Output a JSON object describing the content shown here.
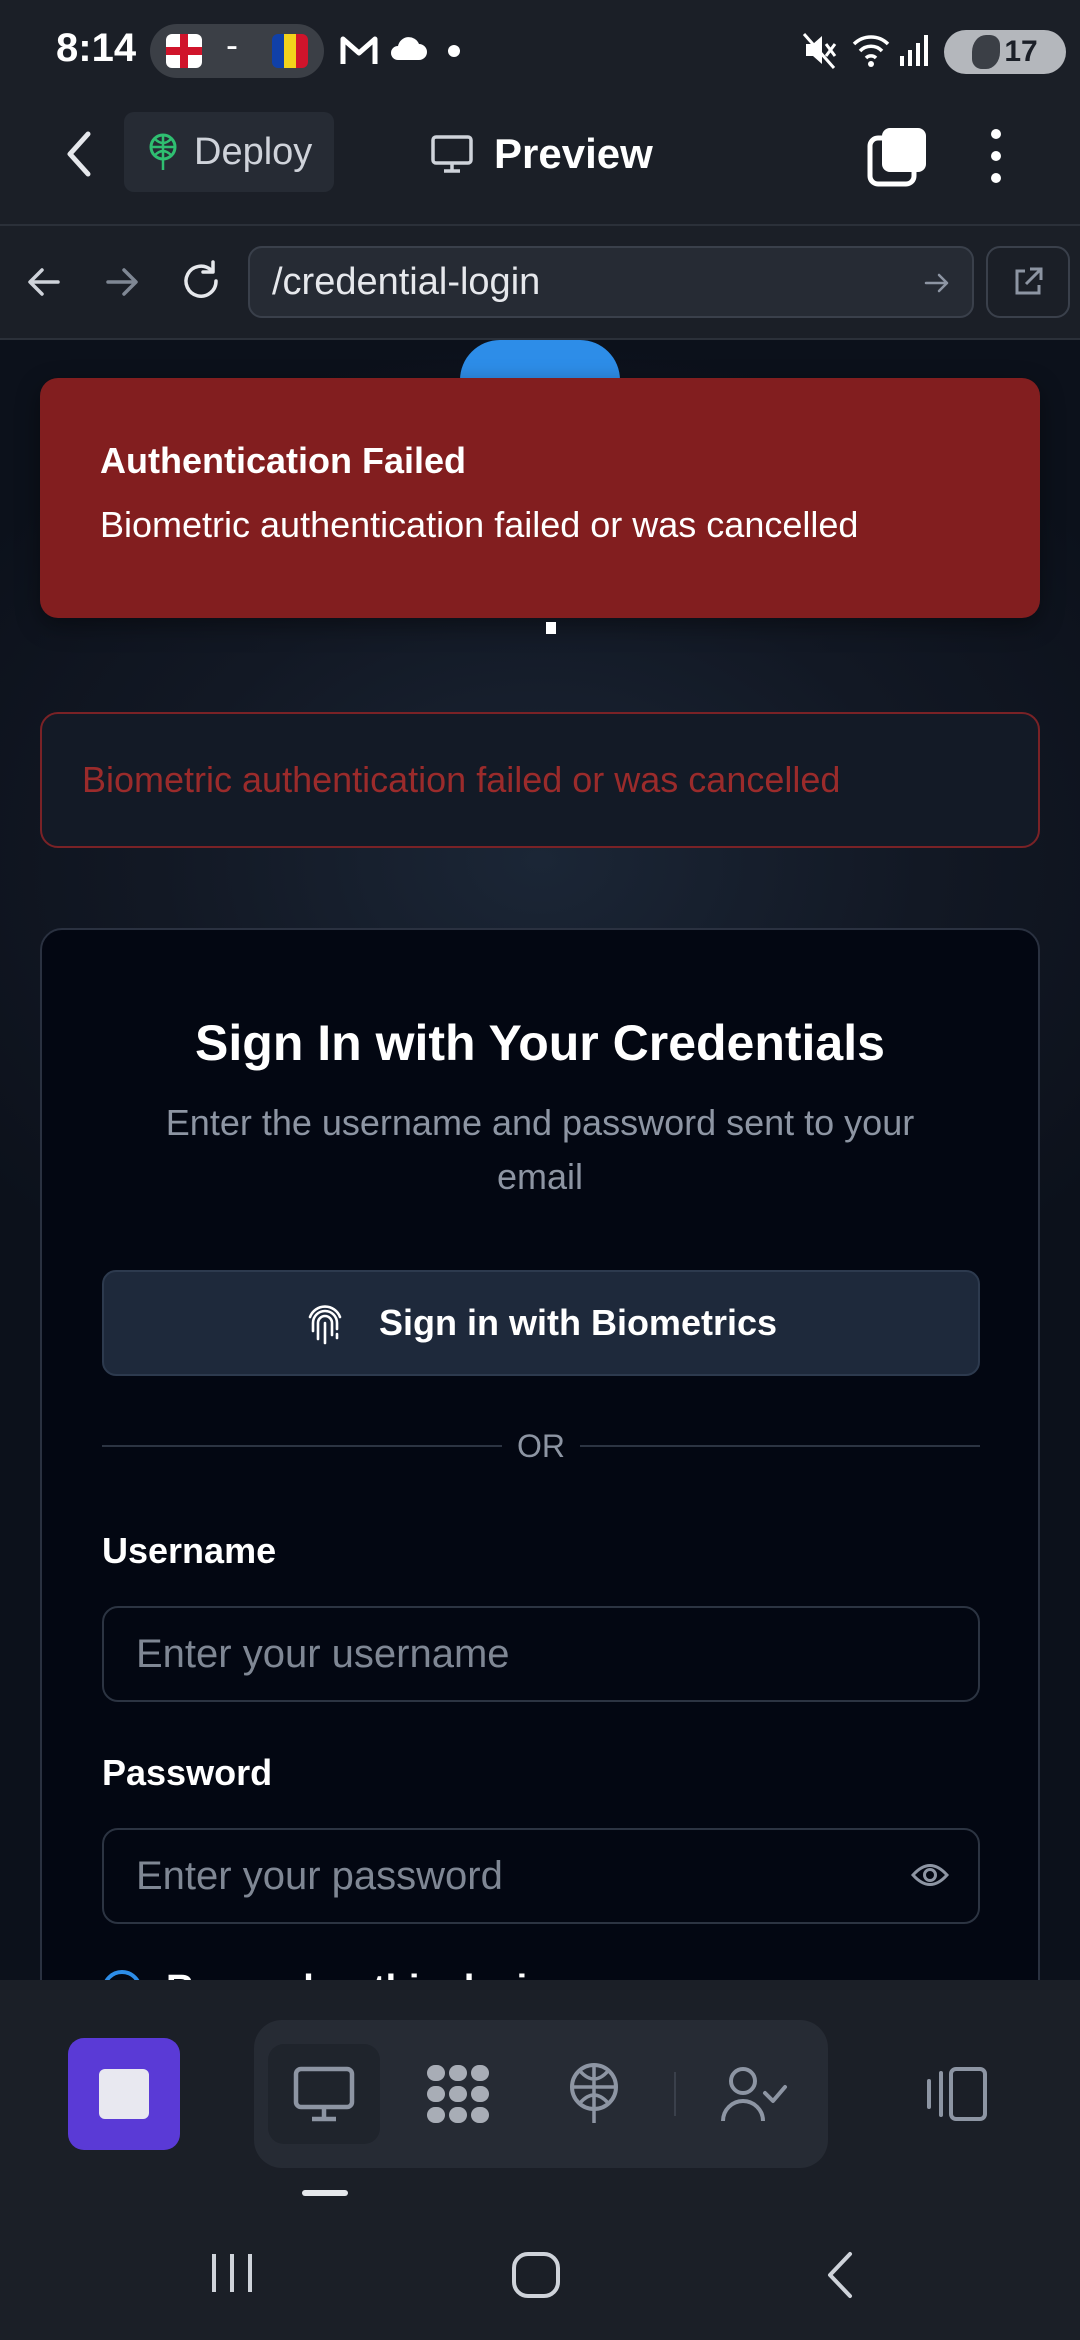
{
  "status_bar": {
    "time": "8:14",
    "notification_separator": "-",
    "battery_level": "17",
    "icons": [
      "england-flag-icon",
      "andorra-flag-icon",
      "gmail-icon",
      "cloud-icon",
      "notification-dot-icon",
      "mute-icon",
      "wifi-icon",
      "signal-icon",
      "battery-icon"
    ]
  },
  "app_header": {
    "deploy_label": "Deploy",
    "preview_label": "Preview"
  },
  "browser": {
    "url": "/credential-login"
  },
  "toast": {
    "title": "Authentication Failed",
    "message": "Biometric authentication failed or was cancelled",
    "color": "#821e1f"
  },
  "error_alert": {
    "message": "Biometric authentication failed or was cancelled"
  },
  "login_card": {
    "title": "Sign In with Your Credentials",
    "subtitle": "Enter the username and password sent to your email",
    "biometric_button_label": "Sign in with Biometrics",
    "divider_text": "OR",
    "username_label": "Username",
    "username_placeholder": "Enter your username",
    "password_label": "Password",
    "password_placeholder": "Enter your password",
    "remember_label": "Remember this device"
  },
  "colors": {
    "accent": "#2d8de8",
    "stop_button": "#5a3ad6",
    "error_text": "#9b2b2b"
  }
}
